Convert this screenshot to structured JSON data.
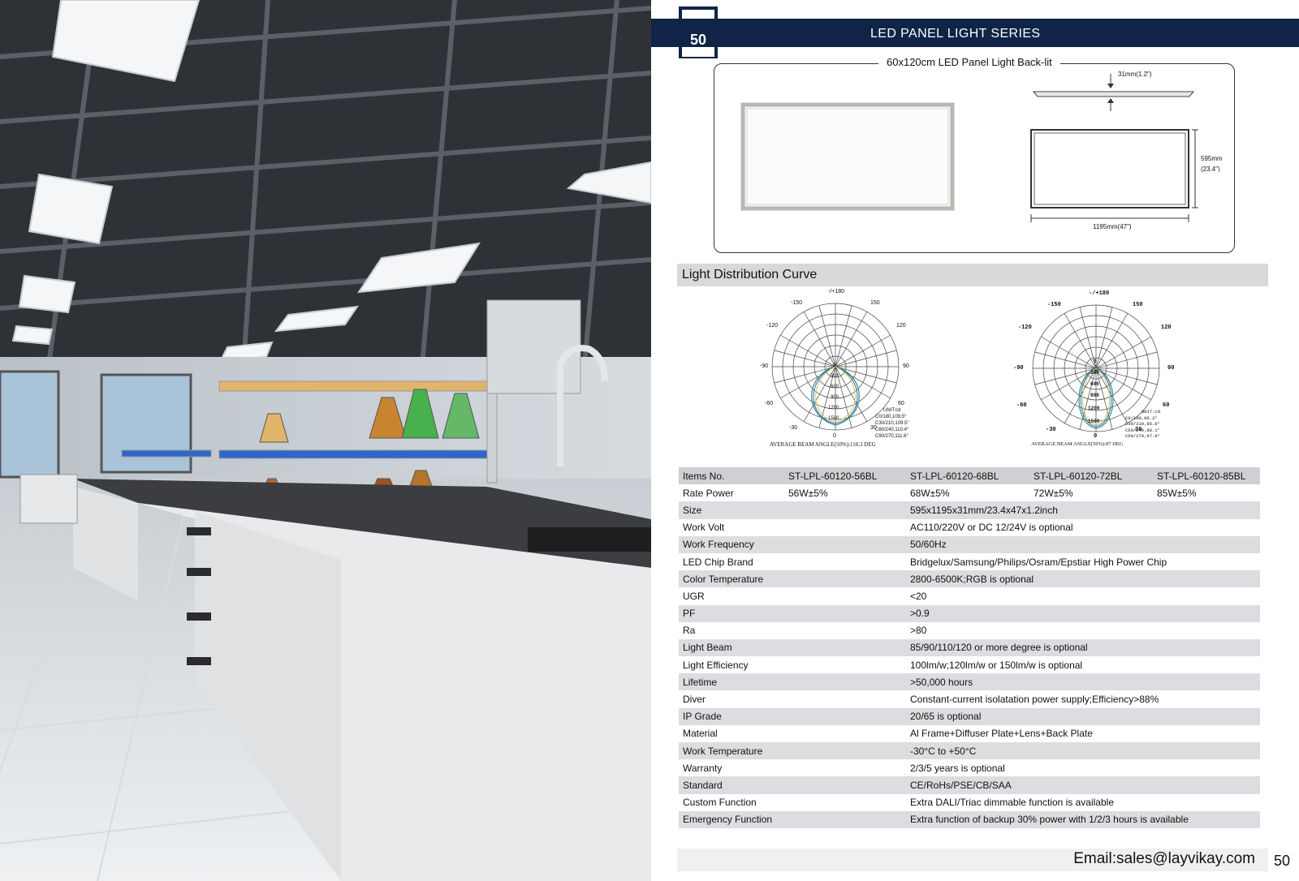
{
  "page_number": "50",
  "series_title": "LED PANEL LIGHT SERIES",
  "product_title": "60x120cm LED Panel Light Back-lit",
  "dimensions": {
    "thickness": "31mm(1.2\")",
    "height_mm": "595mm",
    "height_in": "(23.4\")",
    "width": "1195mm(47\")"
  },
  "section_title": "Light Distribution Curve",
  "polar_charts": [
    {
      "angle_labels": {
        "top": "-/+180",
        "tl": "-150",
        "tr": "150",
        "ul": "-120",
        "ur": "120",
        "ml": "-90",
        "mr": "90",
        "ll": "-60",
        "lr": "60",
        "bl": "-30",
        "br": "30",
        "bottom": "0"
      },
      "radial_labels": [
        "0",
        "300",
        "600",
        "900",
        "1200",
        "1500"
      ],
      "legend": [
        "UNIT:cd",
        "C0/180,109.5°",
        "C30/210,109.5°",
        "C60/240,110.4°",
        "C90/270,111.6°"
      ],
      "caption": "AVERAGE BEAM ANGLE(50%):110.3 DEG"
    },
    {
      "angle_labels": {
        "top": "-/+180",
        "tl": "-150",
        "tr": "150",
        "ul": "-120",
        "ur": "120",
        "ml": "-90",
        "mr": "90",
        "ll": "-60",
        "lr": "60",
        "bl": "-30",
        "br": "30",
        "bottom": "0"
      },
      "radial_labels": [
        "0",
        "300",
        "600",
        "900",
        "1200",
        "1500"
      ],
      "legend": [
        "UNIT:cd",
        "C0/180,86.3°",
        "C30/210,85.8°",
        "C60/240,88.1°",
        "C90/270,87.9°"
      ],
      "caption": "AVERAGE BEAM ANGLE(50%):87 DEG"
    }
  ],
  "spec_table": {
    "header": [
      "Items No.",
      "ST-LPL-60120-56BL",
      "ST-LPL-60120-68BL",
      "ST-LPL-60120-72BL",
      "ST-LPL-60120-85BL"
    ],
    "power": [
      "Rate  Power",
      "56W±5%",
      "68W±5%",
      "72W±5%",
      "85W±5%"
    ],
    "rows": [
      [
        "Size",
        "595x1195x31mm/23.4x47x1.2inch"
      ],
      [
        "Work Volt",
        "AC110/220V or DC 12/24V is optional"
      ],
      [
        "Work Frequency",
        " 50/60Hz"
      ],
      [
        "LED Chip Brand",
        "Bridgelux/Samsung/Philips/Osram/Epstiar High Power Chip"
      ],
      [
        "Color Temperature",
        "2800-6500K;RGB is optional"
      ],
      [
        "UGR",
        " <20"
      ],
      [
        "PF",
        ">0.9"
      ],
      [
        "Ra",
        ">80"
      ],
      [
        "Light Beam",
        "85/90/110/120 or more degree is optional"
      ],
      [
        "Light Efficiency",
        "100lm/w;120lm/w or 150lm/w is optional"
      ],
      [
        "Lifetime",
        ">50,000 hours"
      ],
      [
        "Diver",
        "Constant-current isolatation power supply;Efficiency>88%"
      ],
      [
        "IP Grade",
        "20/65 is optional"
      ],
      [
        "Material",
        "Al Frame+Diffuser Plate+Lens+Back Plate"
      ],
      [
        "Work Temperature",
        "-30°C to +50°C"
      ],
      [
        "Warranty",
        "2/3/5 years is optional"
      ],
      [
        "Standard",
        "CE/RoHs/PSE/CB/SAA"
      ],
      [
        "Custom Function",
        "Extra DALI/Triac dimmable function is available"
      ],
      [
        "Emergency Function",
        "Extra function of backup 30% power with 1/2/3 hours is available"
      ]
    ]
  },
  "footer": {
    "email": "Email:sales@layvikay.com",
    "page": "50"
  },
  "colors": {
    "banner": "#0f2447",
    "row_alt": "#dcdde0",
    "header_row": "#cfd0d3"
  }
}
